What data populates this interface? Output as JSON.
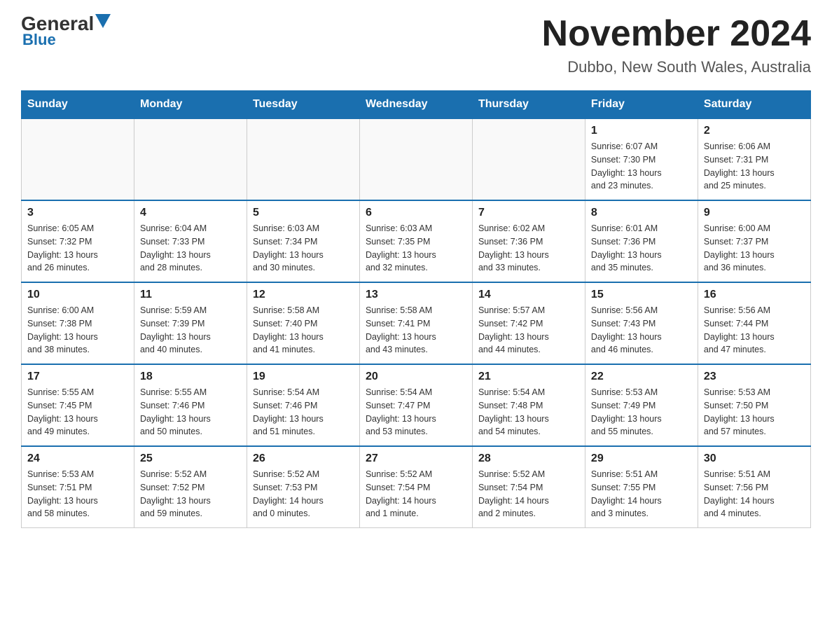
{
  "header": {
    "logo_general": "General",
    "logo_blue": "Blue",
    "title": "November 2024",
    "subtitle": "Dubbo, New South Wales, Australia"
  },
  "days_of_week": [
    "Sunday",
    "Monday",
    "Tuesday",
    "Wednesday",
    "Thursday",
    "Friday",
    "Saturday"
  ],
  "weeks": [
    [
      {
        "day": "",
        "info": ""
      },
      {
        "day": "",
        "info": ""
      },
      {
        "day": "",
        "info": ""
      },
      {
        "day": "",
        "info": ""
      },
      {
        "day": "",
        "info": ""
      },
      {
        "day": "1",
        "info": "Sunrise: 6:07 AM\nSunset: 7:30 PM\nDaylight: 13 hours\nand 23 minutes."
      },
      {
        "day": "2",
        "info": "Sunrise: 6:06 AM\nSunset: 7:31 PM\nDaylight: 13 hours\nand 25 minutes."
      }
    ],
    [
      {
        "day": "3",
        "info": "Sunrise: 6:05 AM\nSunset: 7:32 PM\nDaylight: 13 hours\nand 26 minutes."
      },
      {
        "day": "4",
        "info": "Sunrise: 6:04 AM\nSunset: 7:33 PM\nDaylight: 13 hours\nand 28 minutes."
      },
      {
        "day": "5",
        "info": "Sunrise: 6:03 AM\nSunset: 7:34 PM\nDaylight: 13 hours\nand 30 minutes."
      },
      {
        "day": "6",
        "info": "Sunrise: 6:03 AM\nSunset: 7:35 PM\nDaylight: 13 hours\nand 32 minutes."
      },
      {
        "day": "7",
        "info": "Sunrise: 6:02 AM\nSunset: 7:36 PM\nDaylight: 13 hours\nand 33 minutes."
      },
      {
        "day": "8",
        "info": "Sunrise: 6:01 AM\nSunset: 7:36 PM\nDaylight: 13 hours\nand 35 minutes."
      },
      {
        "day": "9",
        "info": "Sunrise: 6:00 AM\nSunset: 7:37 PM\nDaylight: 13 hours\nand 36 minutes."
      }
    ],
    [
      {
        "day": "10",
        "info": "Sunrise: 6:00 AM\nSunset: 7:38 PM\nDaylight: 13 hours\nand 38 minutes."
      },
      {
        "day": "11",
        "info": "Sunrise: 5:59 AM\nSunset: 7:39 PM\nDaylight: 13 hours\nand 40 minutes."
      },
      {
        "day": "12",
        "info": "Sunrise: 5:58 AM\nSunset: 7:40 PM\nDaylight: 13 hours\nand 41 minutes."
      },
      {
        "day": "13",
        "info": "Sunrise: 5:58 AM\nSunset: 7:41 PM\nDaylight: 13 hours\nand 43 minutes."
      },
      {
        "day": "14",
        "info": "Sunrise: 5:57 AM\nSunset: 7:42 PM\nDaylight: 13 hours\nand 44 minutes."
      },
      {
        "day": "15",
        "info": "Sunrise: 5:56 AM\nSunset: 7:43 PM\nDaylight: 13 hours\nand 46 minutes."
      },
      {
        "day": "16",
        "info": "Sunrise: 5:56 AM\nSunset: 7:44 PM\nDaylight: 13 hours\nand 47 minutes."
      }
    ],
    [
      {
        "day": "17",
        "info": "Sunrise: 5:55 AM\nSunset: 7:45 PM\nDaylight: 13 hours\nand 49 minutes."
      },
      {
        "day": "18",
        "info": "Sunrise: 5:55 AM\nSunset: 7:46 PM\nDaylight: 13 hours\nand 50 minutes."
      },
      {
        "day": "19",
        "info": "Sunrise: 5:54 AM\nSunset: 7:46 PM\nDaylight: 13 hours\nand 51 minutes."
      },
      {
        "day": "20",
        "info": "Sunrise: 5:54 AM\nSunset: 7:47 PM\nDaylight: 13 hours\nand 53 minutes."
      },
      {
        "day": "21",
        "info": "Sunrise: 5:54 AM\nSunset: 7:48 PM\nDaylight: 13 hours\nand 54 minutes."
      },
      {
        "day": "22",
        "info": "Sunrise: 5:53 AM\nSunset: 7:49 PM\nDaylight: 13 hours\nand 55 minutes."
      },
      {
        "day": "23",
        "info": "Sunrise: 5:53 AM\nSunset: 7:50 PM\nDaylight: 13 hours\nand 57 minutes."
      }
    ],
    [
      {
        "day": "24",
        "info": "Sunrise: 5:53 AM\nSunset: 7:51 PM\nDaylight: 13 hours\nand 58 minutes."
      },
      {
        "day": "25",
        "info": "Sunrise: 5:52 AM\nSunset: 7:52 PM\nDaylight: 13 hours\nand 59 minutes."
      },
      {
        "day": "26",
        "info": "Sunrise: 5:52 AM\nSunset: 7:53 PM\nDaylight: 14 hours\nand 0 minutes."
      },
      {
        "day": "27",
        "info": "Sunrise: 5:52 AM\nSunset: 7:54 PM\nDaylight: 14 hours\nand 1 minute."
      },
      {
        "day": "28",
        "info": "Sunrise: 5:52 AM\nSunset: 7:54 PM\nDaylight: 14 hours\nand 2 minutes."
      },
      {
        "day": "29",
        "info": "Sunrise: 5:51 AM\nSunset: 7:55 PM\nDaylight: 14 hours\nand 3 minutes."
      },
      {
        "day": "30",
        "info": "Sunrise: 5:51 AM\nSunset: 7:56 PM\nDaylight: 14 hours\nand 4 minutes."
      }
    ]
  ]
}
